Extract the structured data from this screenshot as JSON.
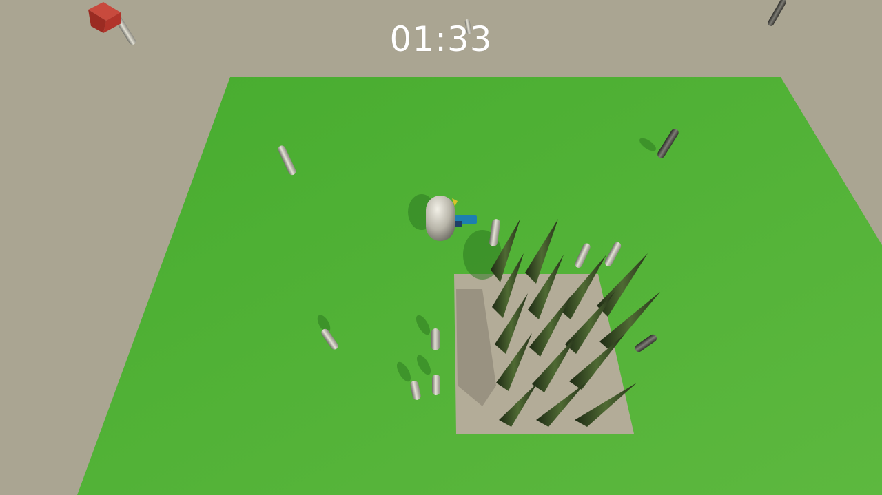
{
  "hud": {
    "timer": "01:33"
  }
}
